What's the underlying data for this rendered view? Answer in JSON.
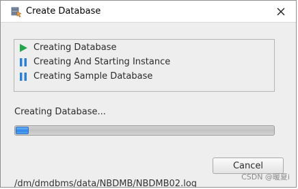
{
  "window": {
    "title": "Create Database",
    "icon": "database-app-icon"
  },
  "steps": [
    {
      "label": "Creating Database",
      "state": "running",
      "icon": "play-icon",
      "color": "#22a84a"
    },
    {
      "label": "Creating And Starting Instance",
      "state": "pending",
      "icon": "pause-icon",
      "color": "#2b7fd8"
    },
    {
      "label": "Creating Sample Database",
      "state": "pending",
      "icon": "pause-icon",
      "color": "#2b7fd8"
    }
  ],
  "status": {
    "text": "Creating Database..."
  },
  "progress": {
    "value": 0.05
  },
  "buttons": {
    "cancel_label": "Cancel"
  },
  "background_text": "/dm/dmdbms/data/NBDMB/NBDMB02.log",
  "watermark": "CSDN @暖夏i"
}
